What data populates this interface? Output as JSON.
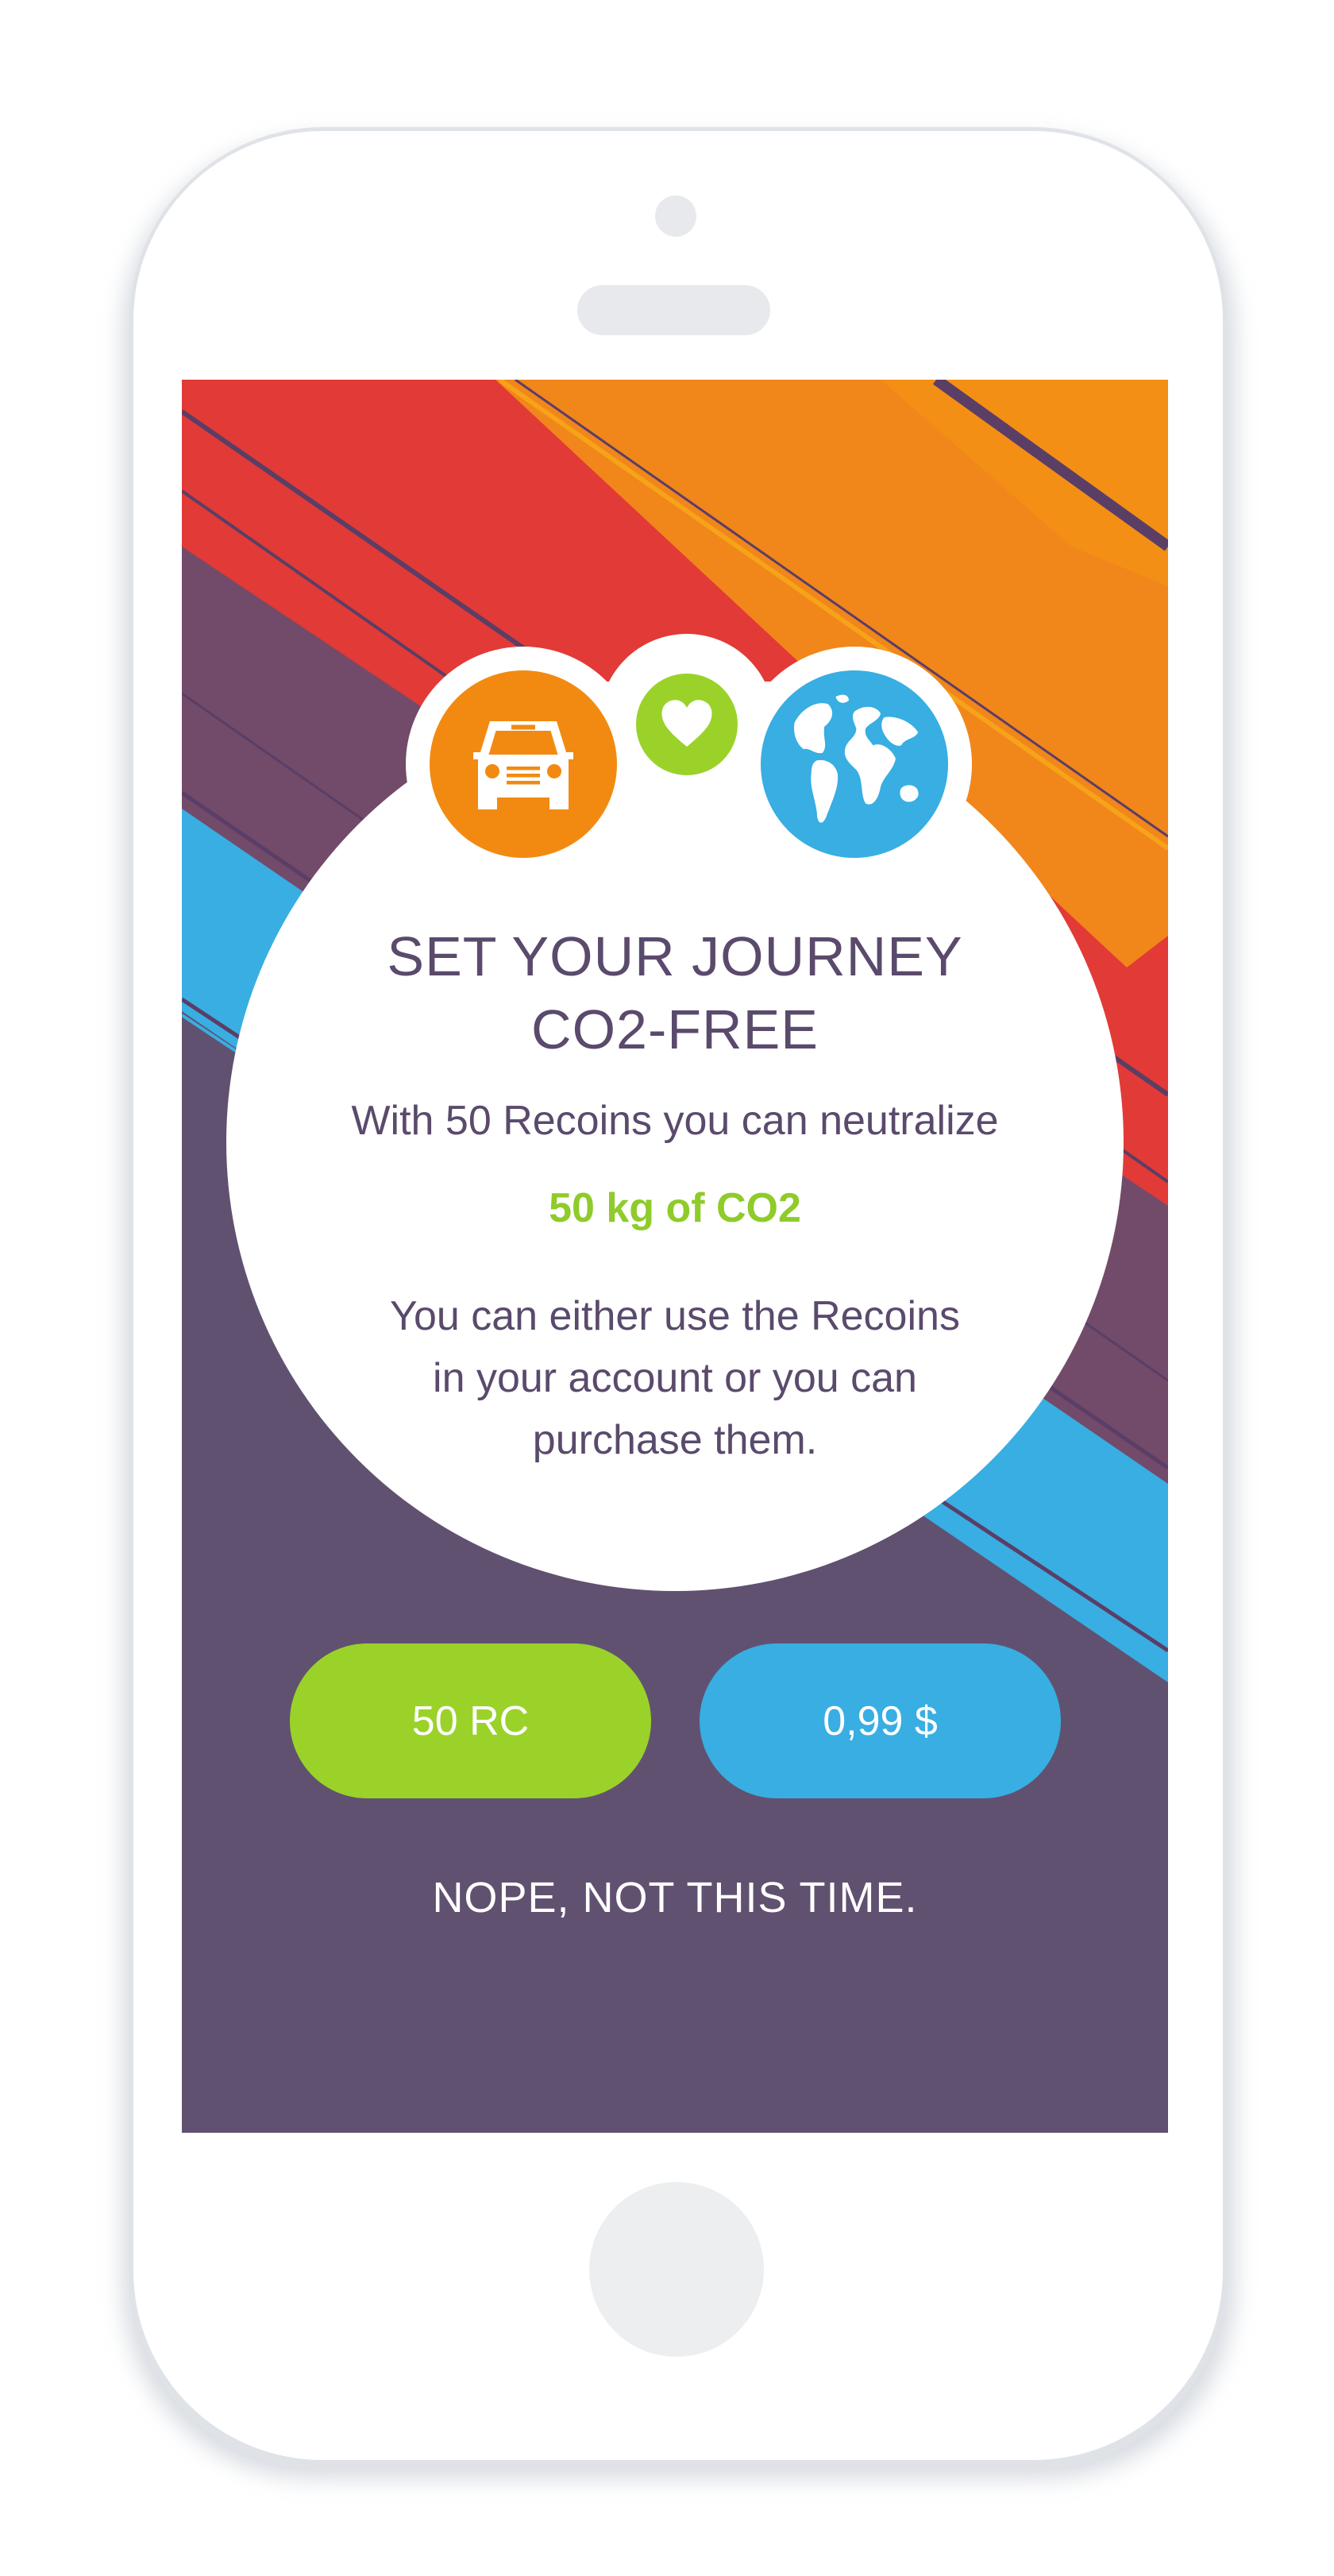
{
  "dialog": {
    "title_line1": "SET YOUR JOURNEY",
    "title_line2": "CO2-FREE",
    "text": "With 50 Recoins you can neutralize",
    "highlight": "50 kg of CO2",
    "note_line1": "You can either use the Recoins",
    "note_line2": "in your account or you can",
    "note_line3": "purchase them."
  },
  "actions": {
    "pay_recoins_label": "50 RC",
    "pay_money_label": "0,99 $",
    "decline_label": "NOPE, NOT THIS TIME."
  },
  "icons": {
    "car": "car-icon",
    "heart": "heart-icon",
    "globe": "globe-icon"
  },
  "colors": {
    "background_purple": "#615170",
    "accent_green": "#9ad22a",
    "accent_blue": "#38aee2",
    "accent_orange": "#f28a12",
    "accent_red": "#e23a36",
    "text_purple": "#5a4a6c"
  }
}
